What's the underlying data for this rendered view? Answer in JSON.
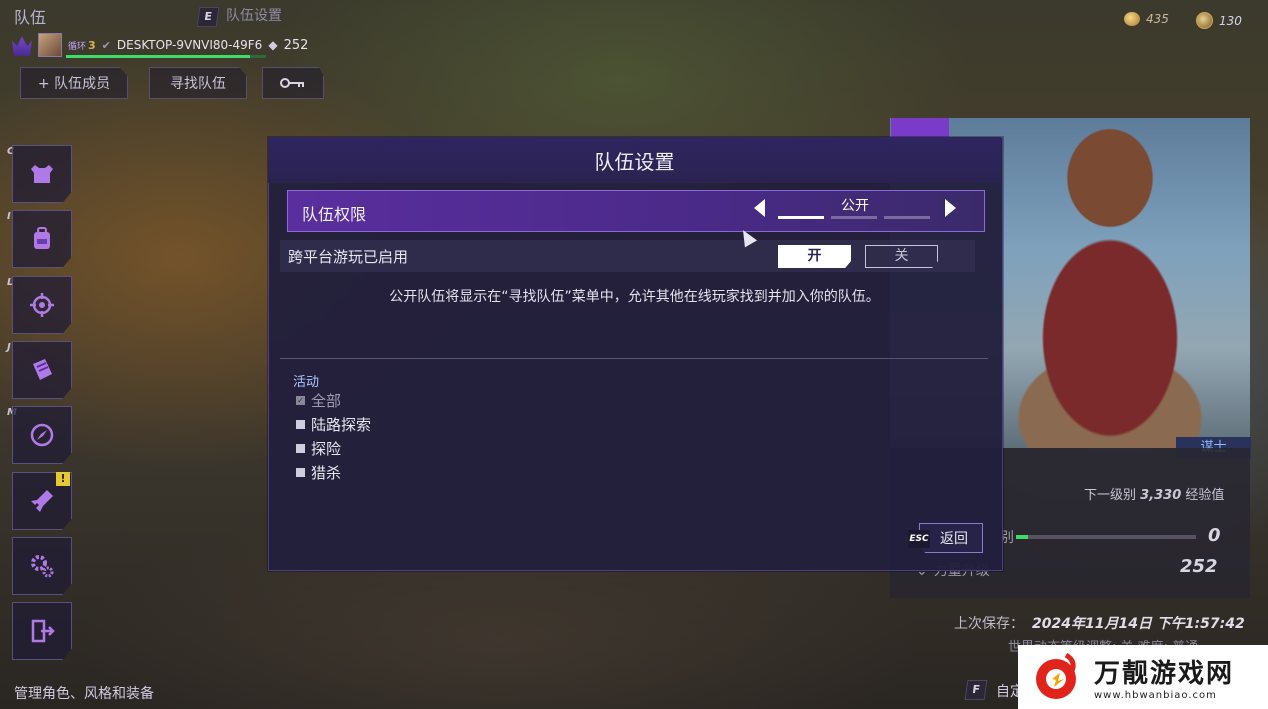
{
  "header": {
    "title": "队伍",
    "settings_key": "E",
    "settings_tab": "队伍设置",
    "player": {
      "rank_prefix": "循环",
      "rank": "3",
      "name": "DESKTOP-9VNVI80-49F6",
      "level": "252"
    },
    "buttons": {
      "add_member": "+ 队伍成员",
      "find_team": "寻找队伍"
    },
    "currency": {
      "coins": "435",
      "tokens": "130"
    }
  },
  "sidebar": {
    "items": [
      {
        "key": "C",
        "icon": "armor-icon"
      },
      {
        "key": "I",
        "icon": "backpack-icon"
      },
      {
        "key": "L",
        "icon": "crosshair-icon"
      },
      {
        "key": "J",
        "icon": "journal-icon"
      },
      {
        "key": "M",
        "icon": "compass-icon"
      },
      {
        "key": "",
        "icon": "skill-tree-icon",
        "alert": "!"
      },
      {
        "key": "",
        "icon": "settings-icon"
      },
      {
        "key": "",
        "icon": "exit-icon"
      }
    ],
    "footer_hint": "管理角色、风格和装备"
  },
  "dialog": {
    "title": "队伍设置",
    "permission": {
      "label": "队伍权限",
      "value": "公开",
      "options_count_selected": 1
    },
    "crossplay": {
      "label": "跨平台游玩已启用",
      "on_label": "开",
      "off_label": "关",
      "enabled": true
    },
    "description": "公开队伍将显示在“寻找队伍”菜单中，允许其他在线玩家找到并加入你的队伍。",
    "activity": {
      "title": "活动",
      "items": [
        {
          "label": "全部",
          "checked": true,
          "dimmed": true
        },
        {
          "label": "陆路探索",
          "checked": false
        },
        {
          "label": "探险",
          "checked": false
        },
        {
          "label": "猎杀",
          "checked": false
        }
      ]
    },
    "back": {
      "key": "ESC",
      "label": "返回"
    }
  },
  "character": {
    "class": "谋士",
    "next_level_prefix": "下一级别",
    "next_level_xp": "3,330",
    "next_level_suffix": "经验值",
    "stat1_label": "别",
    "stat1_value": "0",
    "stat2_label": "力量升级",
    "stat2_value": "252",
    "last_save_label": "上次保存：",
    "last_save_date": "2024年11月14日 下午1:57:42",
    "world_line": "世界动态等级调整: 关  难度: 普通",
    "custom_key": "F",
    "custom_label": "自定"
  },
  "watermark": {
    "title": "万靓游戏网",
    "url": "www.hbwanbiao.com"
  }
}
